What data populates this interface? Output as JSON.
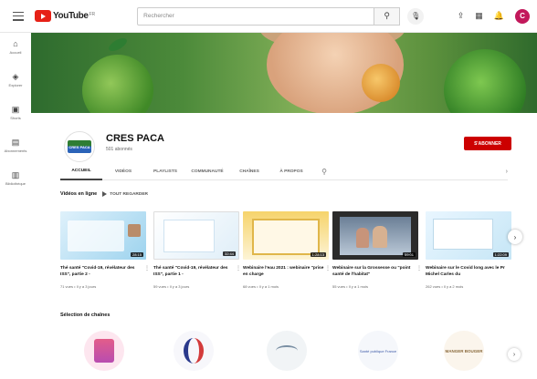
{
  "topbar": {
    "logo_text": "YouTube",
    "logo_country": "FR",
    "search_placeholder": "Rechercher"
  },
  "siderail": [
    {
      "icon": "home-icon",
      "label": "Accueil"
    },
    {
      "icon": "explore-icon",
      "label": "Explorer"
    },
    {
      "icon": "shorts-icon",
      "label": "Shorts"
    },
    {
      "icon": "subscriptions-icon",
      "label": "Abonnements"
    },
    {
      "icon": "library-icon",
      "label": "Bibliothèque"
    }
  ],
  "channel": {
    "name": "CRES PACA",
    "subscribers": "501 abonnés",
    "logo_text": "CRES PACA",
    "subscribe_label": "S'ABONNER"
  },
  "tabs": [
    "ACCUEIL",
    "VIDÉOS",
    "PLAYLISTS",
    "COMMUNAUTÉ",
    "CHAÎNES",
    "À PROPOS"
  ],
  "videos_section": {
    "title": "Vidéos en ligne",
    "play_all": "TOUT REGARDER",
    "videos": [
      {
        "title": "Thé santé \"Covid-19, révélateur des ISS\", partie 2 -",
        "meta": "71 vues • Il y a 3 jours",
        "duration": "28:15"
      },
      {
        "title": "Thé santé \"Covid-19, révélateur des ISS\", partie 1 -",
        "meta": "59 vues • Il y a 3 jours",
        "duration": "32:44"
      },
      {
        "title": "Webinaire l'eau 2021 : webinaire \"prise en charge",
        "meta": "68 vues • Il y a 1 mois",
        "duration": "1:28:13"
      },
      {
        "title": "Webinaire sur la Grossesse ou \"point santé de l'habitat\"",
        "meta": "55 vues • Il y a 1 mois",
        "duration": "59:01"
      },
      {
        "title": "Webinaire sur le Covid long avec le Pr Michel Carles du",
        "meta": "262 vues • Il y a 2 mois",
        "duration": "1:22:09"
      }
    ]
  },
  "channels_section": {
    "title": "Sélection de chaînes",
    "ch4_text": "Santé publique France",
    "ch5_text": "MANGER BOUGER"
  },
  "colors": {
    "brand_red": "#cc0000",
    "avatar": "#c2185b"
  }
}
